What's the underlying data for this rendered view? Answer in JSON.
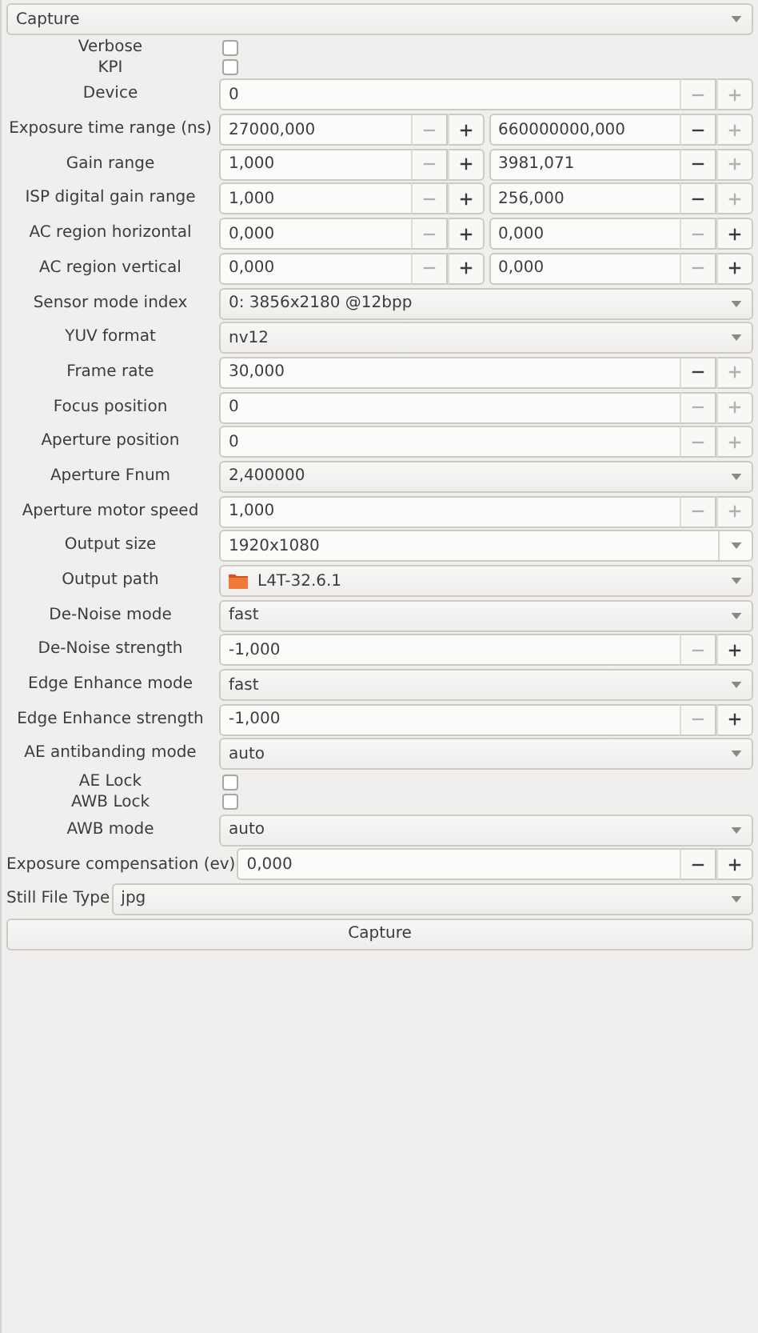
{
  "mode_selector": {
    "value": "Capture"
  },
  "settings": [
    {
      "kind": "checkbox",
      "label": "Verbose",
      "checked": false
    },
    {
      "kind": "checkbox",
      "label": "KPI",
      "checked": false
    },
    {
      "kind": "spin",
      "label": "Device",
      "fields": [
        {
          "value": "0",
          "minus_disabled": true,
          "plus_disabled": true
        }
      ]
    },
    {
      "kind": "spin",
      "label": "Exposure time range (ns)",
      "fields": [
        {
          "value": "27000,000",
          "minus_disabled": true,
          "plus_disabled": false
        },
        {
          "value": "660000000,000",
          "minus_disabled": false,
          "plus_disabled": true
        }
      ]
    },
    {
      "kind": "spin",
      "label": "Gain range",
      "fields": [
        {
          "value": "1,000",
          "minus_disabled": true,
          "plus_disabled": false
        },
        {
          "value": "3981,071",
          "minus_disabled": false,
          "plus_disabled": true
        }
      ]
    },
    {
      "kind": "spin",
      "label": "ISP digital gain range",
      "fields": [
        {
          "value": "1,000",
          "minus_disabled": true,
          "plus_disabled": false
        },
        {
          "value": "256,000",
          "minus_disabled": false,
          "plus_disabled": true
        }
      ]
    },
    {
      "kind": "spin",
      "label": "AC region horizontal",
      "fields": [
        {
          "value": "0,000",
          "minus_disabled": true,
          "plus_disabled": false
        },
        {
          "value": "0,000",
          "minus_disabled": true,
          "plus_disabled": false
        }
      ]
    },
    {
      "kind": "spin",
      "label": "AC region vertical",
      "fields": [
        {
          "value": "0,000",
          "minus_disabled": true,
          "plus_disabled": false
        },
        {
          "value": "0,000",
          "minus_disabled": true,
          "plus_disabled": false
        }
      ]
    },
    {
      "kind": "combo",
      "label": "Sensor mode index",
      "value": "0: 3856x2180 @12bpp"
    },
    {
      "kind": "combo",
      "label": "YUV format",
      "value": "nv12"
    },
    {
      "kind": "spin",
      "label": "Frame rate",
      "fields": [
        {
          "value": "30,000",
          "minus_disabled": false,
          "plus_disabled": true
        }
      ]
    },
    {
      "kind": "spin",
      "label": "Focus position",
      "fields": [
        {
          "value": "0",
          "minus_disabled": true,
          "plus_disabled": true
        }
      ]
    },
    {
      "kind": "spin",
      "label": "Aperture position",
      "fields": [
        {
          "value": "0",
          "minus_disabled": true,
          "plus_disabled": true
        }
      ]
    },
    {
      "kind": "combo",
      "label": "Aperture Fnum",
      "value": "2,400000"
    },
    {
      "kind": "spin",
      "label": "Aperture motor speed",
      "fields": [
        {
          "value": "1,000",
          "minus_disabled": true,
          "plus_disabled": true
        }
      ]
    },
    {
      "kind": "entry_combo",
      "label": "Output size",
      "value": "1920x1080"
    },
    {
      "kind": "path",
      "label": "Output path",
      "value": "L4T-32.6.1"
    },
    {
      "kind": "combo",
      "label": "De-Noise mode",
      "value": "fast"
    },
    {
      "kind": "spin",
      "label": "De-Noise strength",
      "fields": [
        {
          "value": "-1,000",
          "minus_disabled": true,
          "plus_disabled": false
        }
      ]
    },
    {
      "kind": "combo",
      "label": "Edge Enhance mode",
      "value": "fast"
    },
    {
      "kind": "spin",
      "label": "Edge Enhance strength",
      "fields": [
        {
          "value": "-1,000",
          "minus_disabled": true,
          "plus_disabled": false
        }
      ]
    },
    {
      "kind": "combo",
      "label": "AE antibanding mode",
      "value": "auto"
    },
    {
      "kind": "checkbox",
      "label": "AE Lock",
      "checked": false
    },
    {
      "kind": "checkbox",
      "label": "AWB Lock",
      "checked": false
    },
    {
      "kind": "combo",
      "label": "AWB mode",
      "value": "auto"
    }
  ],
  "footer_rows": [
    {
      "kind": "spin",
      "label": "Exposure compensation (ev)",
      "fields": [
        {
          "value": "0,000",
          "minus_disabled": false,
          "plus_disabled": false
        }
      ]
    },
    {
      "kind": "combo",
      "label": "Still File Type",
      "value": "jpg"
    }
  ],
  "capture_button": "Capture"
}
